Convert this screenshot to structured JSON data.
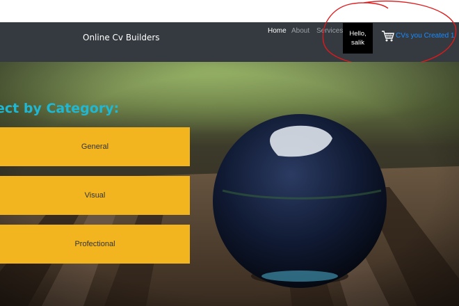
{
  "navbar": {
    "brand": "Online Cv Builders",
    "links": [
      "Home",
      "About",
      "Services"
    ],
    "greeting_line1": "Hello,",
    "greeting_line2": "salik",
    "cart_text": "CVs you Created 1"
  },
  "hero": {
    "heading": "ect by Category:",
    "categories": [
      "General",
      "Visual",
      "Profectional"
    ]
  },
  "colors": {
    "navbar_bg": "#343a40",
    "accent_heading": "#1fb8d4",
    "button_bg": "#f2b51f",
    "cart_link": "#1a8cff",
    "annotation": "#e0191b"
  }
}
